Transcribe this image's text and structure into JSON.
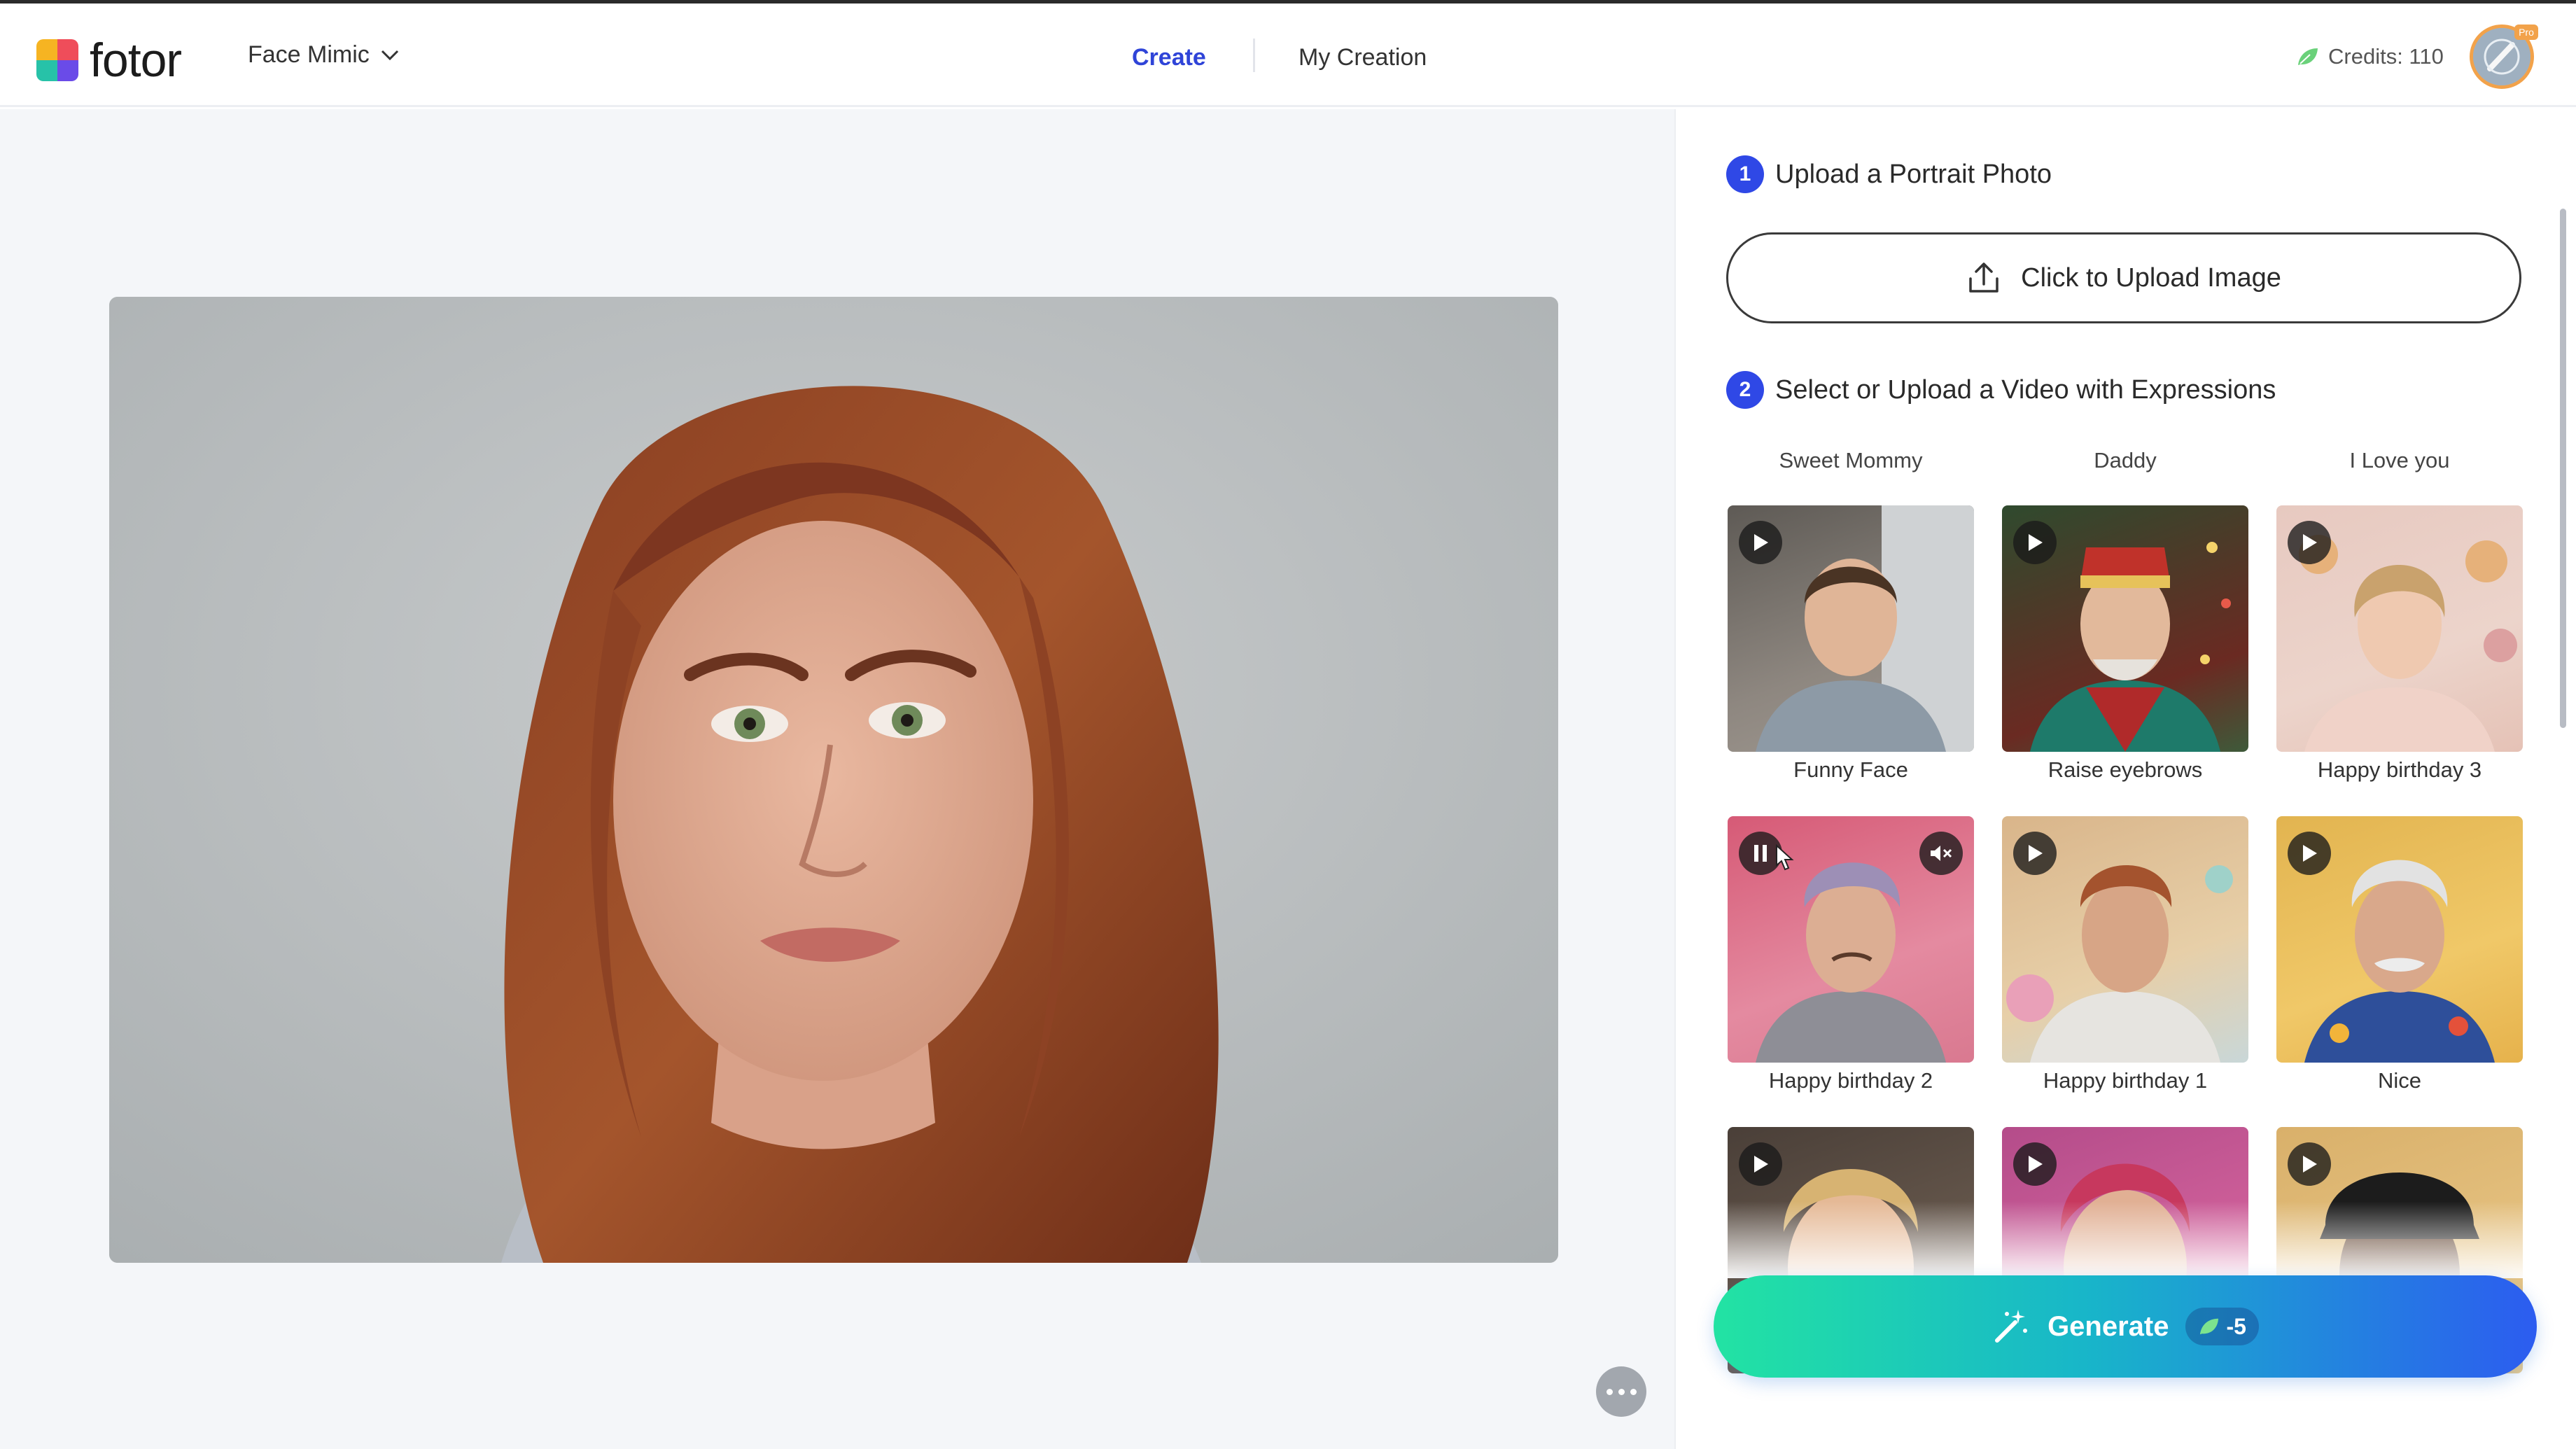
{
  "header": {
    "logo_text": "fotor",
    "tool_name": "Face Mimic",
    "nav_create": "Create",
    "nav_my_creation": "My Creation",
    "credits_label": "Credits: 110",
    "avatar_badge": "Pro"
  },
  "panel": {
    "step1": {
      "number": "1",
      "title": "Upload a Portrait Photo"
    },
    "upload_button": "Click to Upload Image",
    "step2": {
      "number": "2",
      "title": "Select or Upload a Video with Expressions"
    },
    "column_labels": [
      "Sweet Mommy",
      "Daddy",
      "I Love you"
    ],
    "templates": [
      {
        "label": "Funny Face",
        "state": "paused"
      },
      {
        "label": "Raise eyebrows",
        "state": "paused"
      },
      {
        "label": "Happy birthday 3",
        "state": "paused"
      },
      {
        "label": "Happy birthday 2",
        "state": "playing"
      },
      {
        "label": "Happy birthday 1",
        "state": "paused"
      },
      {
        "label": "Nice",
        "state": "paused"
      },
      {
        "label": "",
        "state": "paused"
      },
      {
        "label": "",
        "state": "paused"
      },
      {
        "label": "",
        "state": "paused"
      }
    ],
    "generate": {
      "label": "Generate",
      "cost": "-5"
    }
  },
  "colors": {
    "accent": "#2f48e6",
    "nav_active": "#2f44d8",
    "generate_gradient": [
      "#22e3a3",
      "#18b6c9",
      "#2c5cf0"
    ],
    "canvas_bg": "#f4f6f9"
  }
}
